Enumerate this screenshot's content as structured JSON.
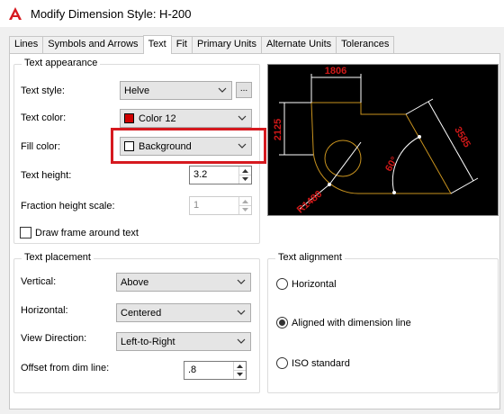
{
  "window": {
    "title": "Modify Dimension Style: H-200"
  },
  "tabs": [
    {
      "label": "Lines"
    },
    {
      "label": "Symbols and Arrows"
    },
    {
      "label": "Text"
    },
    {
      "label": "Fit"
    },
    {
      "label": "Primary Units"
    },
    {
      "label": "Alternate Units"
    },
    {
      "label": "Tolerances"
    }
  ],
  "active_tab": "Text",
  "text_appearance": {
    "group_label": "Text appearance",
    "text_style": {
      "label": "Text style:",
      "value": "Helve",
      "button_label": "..."
    },
    "text_color": {
      "label": "Text color:",
      "value": "Color 12",
      "swatch_color": "#d00000"
    },
    "fill_color": {
      "label": "Fill color:",
      "value": "Background",
      "swatch_color": "#ffffff",
      "highlighted": true
    },
    "text_height": {
      "label": "Text height:",
      "value": "3.2"
    },
    "fraction_height_scale": {
      "label": "Fraction height scale:",
      "value": "1",
      "enabled": false
    },
    "draw_frame": {
      "label": "Draw frame around text",
      "checked": false
    }
  },
  "text_placement": {
    "group_label": "Text placement",
    "vertical": {
      "label": "Vertical:",
      "value": "Above"
    },
    "horizontal": {
      "label": "Horizontal:",
      "value": "Centered"
    },
    "view_direction": {
      "label": "View Direction:",
      "value": "Left-to-Right"
    },
    "offset": {
      "label": "Offset from dim line:",
      "value": ".8"
    }
  },
  "text_alignment": {
    "group_label": "Text alignment",
    "options": [
      {
        "label": "Horizontal",
        "selected": false
      },
      {
        "label": "Aligned with dimension line",
        "selected": true
      },
      {
        "label": "ISO standard",
        "selected": false
      }
    ]
  },
  "preview": {
    "dim_top": "1806",
    "dim_left": "2125",
    "dim_right": "3585",
    "dim_angle": "60°",
    "dim_radius": "R1480",
    "colors": {
      "background": "#000000",
      "geometry": "#c8921e",
      "dimension_text": "#d01818",
      "dimension_lines": "#ffffff"
    }
  },
  "colors": {
    "highlight_border": "#d6191f",
    "logo": "#d6191f"
  }
}
